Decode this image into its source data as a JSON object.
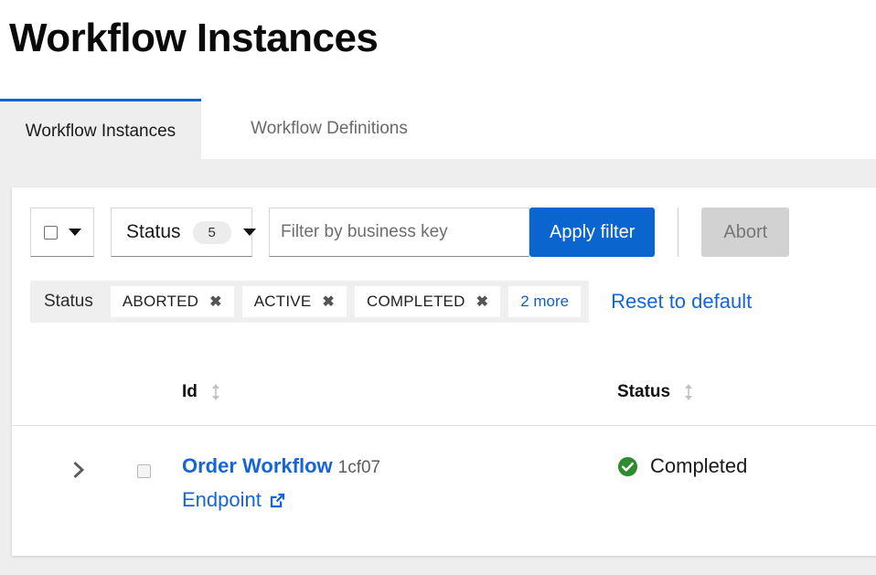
{
  "header": {
    "title": "Workflow Instances"
  },
  "tabs": [
    {
      "label": "Workflow Instances",
      "active": true
    },
    {
      "label": "Workflow Definitions",
      "active": false
    }
  ],
  "filter_bar": {
    "select_all": {
      "icon": "checkbox-icon",
      "caret": "chevron-down-icon"
    },
    "status_select": {
      "label": "Status",
      "count": "5",
      "caret": "chevron-down-icon"
    },
    "business_key": {
      "value": "",
      "placeholder": "Filter by business key"
    },
    "apply_label": "Apply filter",
    "abort_label": "Abort"
  },
  "active_filters": {
    "label": "Status",
    "chips": [
      {
        "label": "ABORTED",
        "remove_icon": "close-icon"
      },
      {
        "label": "ACTIVE",
        "remove_icon": "close-icon"
      },
      {
        "label": "COMPLETED",
        "remove_icon": "close-icon"
      }
    ],
    "more_label": "2 more",
    "reset_label": "Reset to default"
  },
  "table": {
    "columns": [
      {
        "label": "Id",
        "sort_icon": "sort-updown-icon"
      },
      {
        "label": "Status",
        "sort_icon": "sort-updown-icon"
      }
    ],
    "rows": [
      {
        "expand_icon": "chevron-right-icon",
        "selected": false,
        "name": "Order Workflow",
        "short_id": "1cf07",
        "endpoint_label": "Endpoint",
        "endpoint_icon": "external-link-icon",
        "status": "Completed",
        "status_icon": "check-circle-icon"
      }
    ]
  },
  "colors": {
    "accent_blue": "#0b65ce",
    "link_blue": "#1565d8",
    "success_green": "#2e8b30",
    "page_bg": "#eeeeee",
    "disabled_gray": "#d2d2d2"
  }
}
